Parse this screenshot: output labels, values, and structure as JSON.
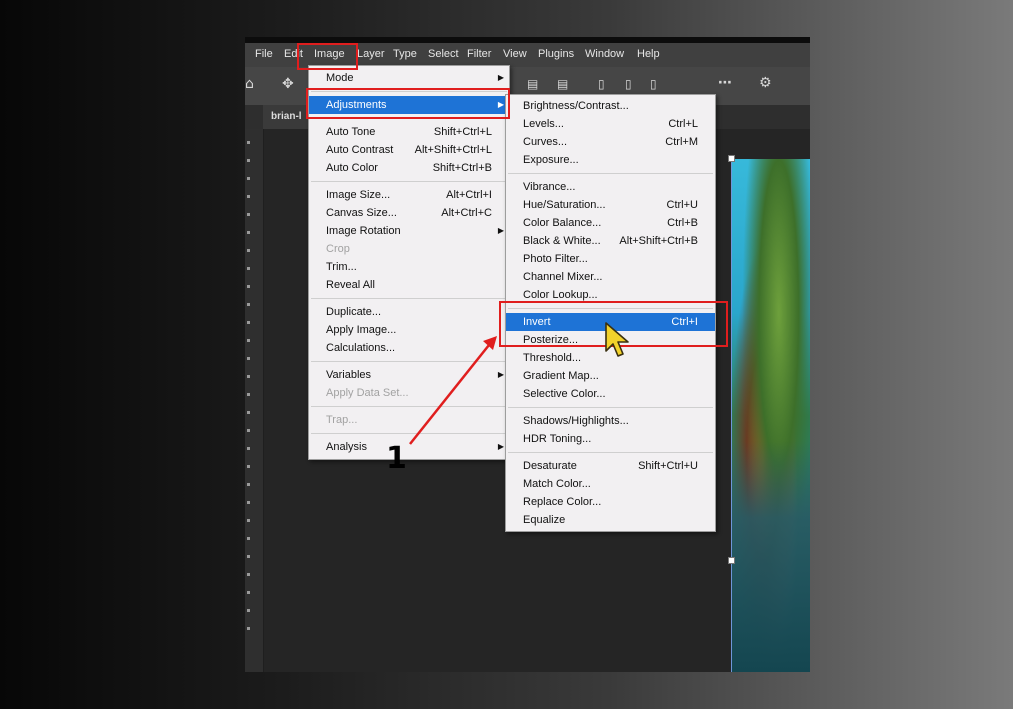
{
  "menubar": {
    "items": [
      "File",
      "Edit",
      "Image",
      "Layer",
      "Type",
      "Select",
      "Filter",
      "View",
      "Plugins",
      "Window",
      "Help"
    ]
  },
  "document": {
    "tab_title": "brian-l"
  },
  "image_menu": {
    "groups": [
      [
        {
          "label": "Mode",
          "submenu": true
        }
      ],
      [
        {
          "label": "Adjustments",
          "submenu": true,
          "highlighted": true
        }
      ],
      [
        {
          "label": "Auto Tone",
          "shortcut": "Shift+Ctrl+L"
        },
        {
          "label": "Auto Contrast",
          "shortcut": "Alt+Shift+Ctrl+L"
        },
        {
          "label": "Auto Color",
          "shortcut": "Shift+Ctrl+B"
        }
      ],
      [
        {
          "label": "Image Size...",
          "shortcut": "Alt+Ctrl+I"
        },
        {
          "label": "Canvas Size...",
          "shortcut": "Alt+Ctrl+C"
        },
        {
          "label": "Image Rotation",
          "submenu": true
        },
        {
          "label": "Crop",
          "disabled": true
        },
        {
          "label": "Trim..."
        },
        {
          "label": "Reveal All"
        }
      ],
      [
        {
          "label": "Duplicate..."
        },
        {
          "label": "Apply Image..."
        },
        {
          "label": "Calculations..."
        }
      ],
      [
        {
          "label": "Variables",
          "submenu": true
        },
        {
          "label": "Apply Data Set...",
          "disabled": true
        }
      ],
      [
        {
          "label": "Trap...",
          "disabled": true
        }
      ],
      [
        {
          "label": "Analysis",
          "submenu": true
        }
      ]
    ]
  },
  "adjustments_menu": {
    "groups": [
      [
        {
          "label": "Brightness/Contrast..."
        },
        {
          "label": "Levels...",
          "shortcut": "Ctrl+L"
        },
        {
          "label": "Curves...",
          "shortcut": "Ctrl+M"
        },
        {
          "label": "Exposure..."
        }
      ],
      [
        {
          "label": "Vibrance..."
        },
        {
          "label": "Hue/Saturation...",
          "shortcut": "Ctrl+U"
        },
        {
          "label": "Color Balance...",
          "shortcut": "Ctrl+B"
        },
        {
          "label": "Black & White...",
          "shortcut": "Alt+Shift+Ctrl+B"
        },
        {
          "label": "Photo Filter..."
        },
        {
          "label": "Channel Mixer..."
        },
        {
          "label": "Color Lookup..."
        }
      ],
      [
        {
          "label": "Invert",
          "shortcut": "Ctrl+I",
          "highlighted": true
        },
        {
          "label": "Posterize..."
        },
        {
          "label": "Threshold..."
        },
        {
          "label": "Gradient Map..."
        },
        {
          "label": "Selective Color..."
        }
      ],
      [
        {
          "label": "Shadows/Highlights..."
        },
        {
          "label": "HDR Toning..."
        }
      ],
      [
        {
          "label": "Desaturate",
          "shortcut": "Shift+Ctrl+U"
        },
        {
          "label": "Match Color..."
        },
        {
          "label": "Replace Color..."
        },
        {
          "label": "Equalize"
        }
      ]
    ]
  },
  "annotation": {
    "step_number": "1"
  },
  "colors": {
    "highlight": "#1e73d6",
    "annotation_red": "#e01e1e",
    "menu_bg": "#f2f0f2"
  }
}
